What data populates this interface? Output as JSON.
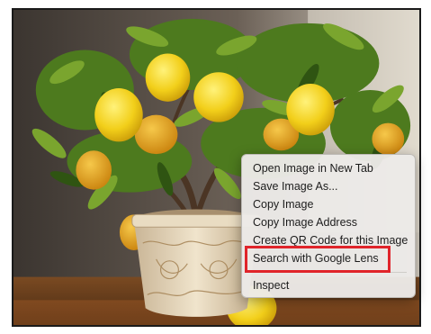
{
  "context_menu": {
    "items": [
      {
        "label": "Open Image in New Tab"
      },
      {
        "label": "Save Image As..."
      },
      {
        "label": "Copy Image"
      },
      {
        "label": "Copy Image Address"
      },
      {
        "label": "Create QR Code for this Image"
      },
      {
        "label": "Search with Google Lens",
        "highlighted": true
      },
      {
        "label": "Inspect"
      }
    ]
  },
  "annotation": {
    "highlight_color": "#e0242a"
  },
  "photo": {
    "subject": "potted lemon tree"
  }
}
